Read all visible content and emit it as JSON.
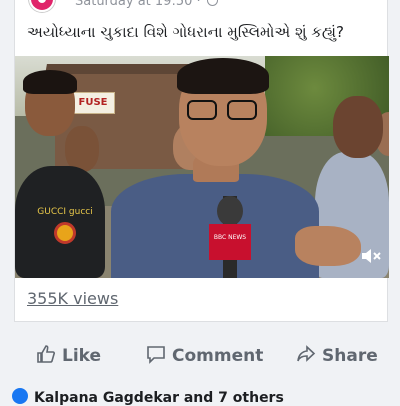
{
  "post": {
    "timestamp": "Saturday at 19:50 ·",
    "caption": "અયોધ્યાના ચુકાદા વિશે ગોધરાના મુસ્લિમોએ શું કહ્યું?",
    "video": {
      "shop_sign": "FUSE",
      "shirt_text": "GUCCI\ngucci",
      "mic_flag_text": "BBC NEWS",
      "muted": true
    },
    "views": "355K views"
  },
  "actions": {
    "like_label": "Like",
    "comment_label": "Comment",
    "share_label": "Share"
  },
  "reactions": {
    "summary": "Kalpana Gagdekar and 7 others"
  },
  "colors": {
    "background": "#f0f2f5",
    "card": "#ffffff",
    "secondary_text": "#606770",
    "reaction_blue": "#1877f2",
    "bbc_red": "#c8102e"
  }
}
